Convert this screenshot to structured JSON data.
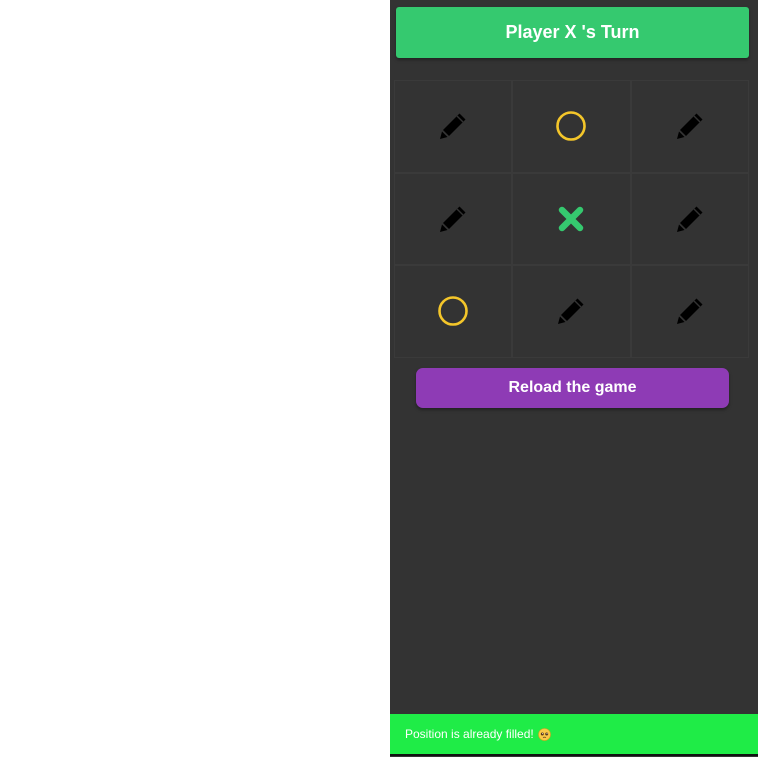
{
  "header": {
    "turn_text": "Player X 's Turn"
  },
  "board": {
    "cells": [
      "empty",
      "O",
      "empty",
      "empty",
      "X",
      "empty",
      "O",
      "empty",
      "empty"
    ],
    "icons": {
      "empty": "pencil-icon",
      "O": "circle-o-icon",
      "X": "cross-x-icon"
    }
  },
  "controls": {
    "reload_label": "Reload the game"
  },
  "toast": {
    "message": "Position is already filled!",
    "emoji": "pleading-face-emoji"
  },
  "colors": {
    "banner": "#35c96f",
    "background": "#333333",
    "x_mark": "#35c96f",
    "o_mark": "#f4c62a",
    "pencil": "#000000",
    "reload_button": "#8e3bb5",
    "toast": "#1fec47"
  }
}
